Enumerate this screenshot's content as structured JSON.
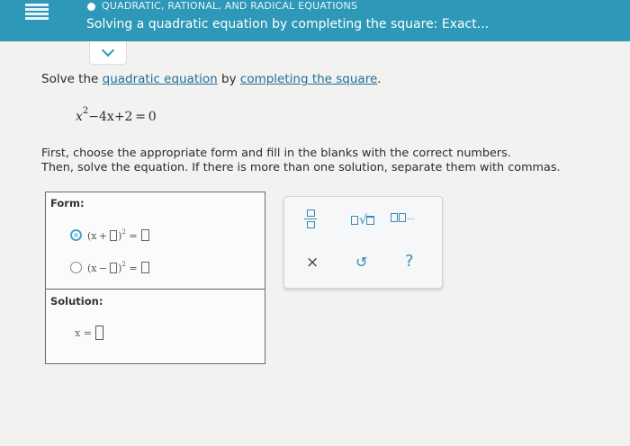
{
  "header": {
    "category": "QUADRATIC, RATIONAL, AND RADICAL EQUATIONS",
    "title": "Solving a quadratic equation by completing the square: Exact..."
  },
  "problem": {
    "prompt_start": "Solve the ",
    "link1": "quadratic equation",
    "prompt_mid": " by ",
    "link2": "completing the square",
    "prompt_end": ".",
    "eq_var": "x",
    "eq_exp": "2",
    "eq_rest": "−4x+2 = 0",
    "instruction_line1": "First, choose the appropriate form and fill in the blanks with the correct numbers.",
    "instruction_line2": "Then, solve the equation. If there is more than one solution, separate them with commas."
  },
  "form": {
    "label": "Form:",
    "option1": {
      "open": "(x + ",
      "close": ")",
      "exp": "2",
      "eq": " = ",
      "selected": true
    },
    "option2": {
      "open": "(x − ",
      "close": ")",
      "exp": "2",
      "eq": " = ",
      "selected": false
    },
    "solution_label": "Solution:",
    "solution_prefix": "x ="
  },
  "tools": {
    "icons": [
      "fraction-icon",
      "sqrt-icon",
      "list-icon",
      "clear-icon",
      "undo-icon",
      "help-icon"
    ],
    "list_ellipsis": "...",
    "clear_glyph": "×",
    "undo_glyph": "↺",
    "help_glyph": "?"
  },
  "colors": {
    "header": "#2e98b8",
    "link": "#1f6f9a",
    "accent": "#3a8ab5"
  }
}
